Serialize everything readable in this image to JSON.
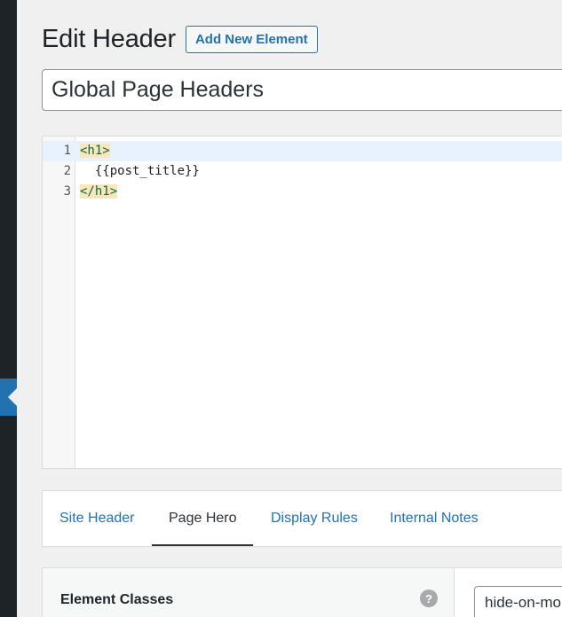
{
  "header": {
    "title": "Edit Header",
    "add_new_label": "Add New Element"
  },
  "element_title": "Global Page Headers",
  "code": {
    "lines": [
      {
        "number": "1",
        "open_tag": "<h1>"
      },
      {
        "number": "2",
        "text": "  {{post_title}}"
      },
      {
        "number": "3",
        "close_tag": "</h1>"
      }
    ]
  },
  "tabs": [
    {
      "label": "Site Header",
      "active": false
    },
    {
      "label": "Page Hero",
      "active": true
    },
    {
      "label": "Display Rules",
      "active": false
    },
    {
      "label": "Internal Notes",
      "active": false
    }
  ],
  "options": {
    "element_classes_label": "Element Classes",
    "help_glyph": "?",
    "element_classes_value": "hide-on-mobile"
  },
  "colors": {
    "accent": "#2271b1",
    "admin_bar": "#1d2327",
    "background": "#f0f0f1"
  }
}
